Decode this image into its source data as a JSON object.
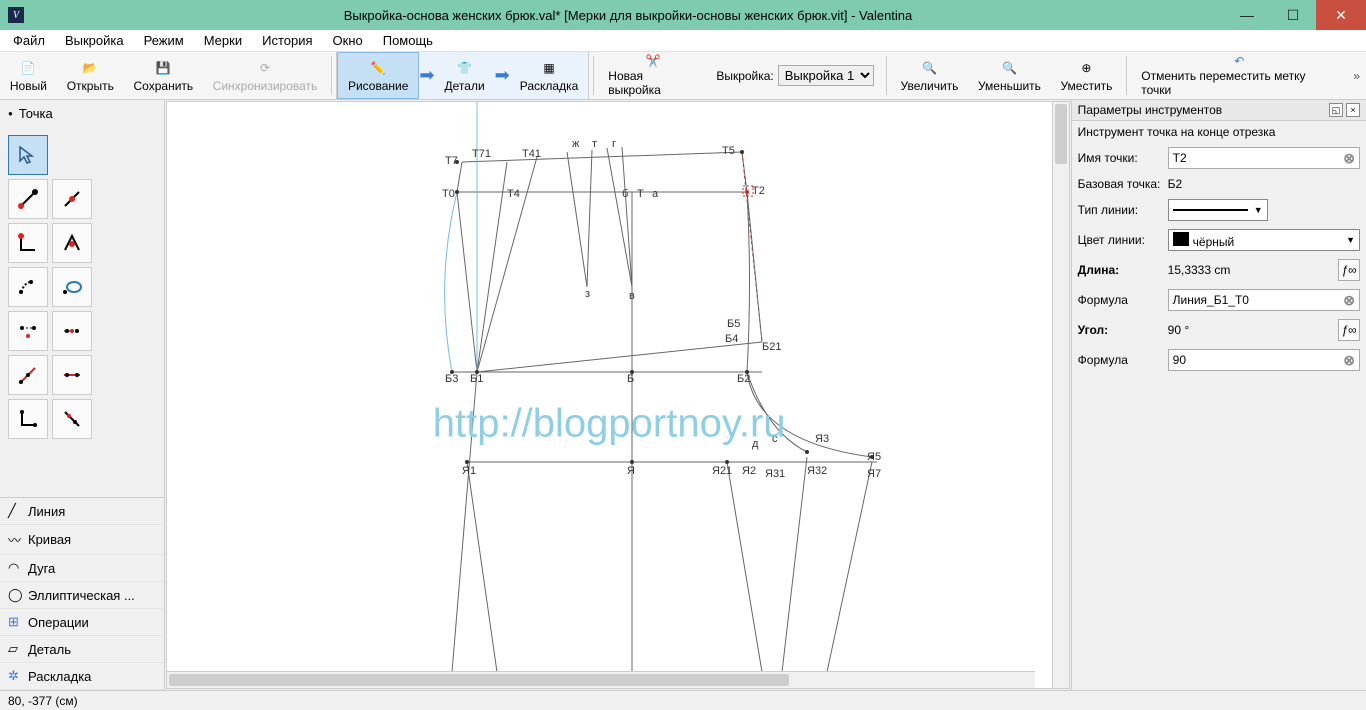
{
  "window": {
    "title": "Выкройка-основа женских брюк.val* [Мерки для выкройки-основы женских брюк.vit] - Valentina"
  },
  "menu": [
    "Файл",
    "Выкройка",
    "Режим",
    "Мерки",
    "История",
    "Окно",
    "Помощь"
  ],
  "toolbar": {
    "new": "Новый",
    "open": "Открыть",
    "save": "Сохранить",
    "sync": "Синхронизировать",
    "draw": "Рисование",
    "details": "Детали",
    "layout": "Раскладка",
    "newpattern": "Новая выкройка",
    "pattern_label": "Выкройка:",
    "pattern_value": "Выкройка 1",
    "zoomin": "Увеличить",
    "zoomout": "Уменьшить",
    "fit": "Уместить",
    "undo_move": "Отменить переместить метку точки"
  },
  "sidebar": {
    "section": "Точка",
    "cats": {
      "line": "Линия",
      "curve": "Кривая",
      "arc": "Дуга",
      "elliptic": "Эллиптическая ...",
      "ops": "Операции",
      "detail": "Деталь",
      "layout": "Раскладка"
    }
  },
  "canvas": {
    "watermark": "http://blogportnoy.ru",
    "points": {
      "T7": "Т7",
      "T71": "Т71",
      "T41": "Т41",
      "zh": "ж",
      "t": "т",
      "g": "г",
      "T5": "Т5",
      "T0": "Т0",
      "T4": "Т4",
      "B_sm": "б",
      "T": "Т",
      "a": "а",
      "T2": "Т2",
      "zv": "з",
      "v": "в",
      "B4": "Б4",
      "B5": "Б5",
      "B21": "Б21",
      "B3": "Б3",
      "B1": "Б1",
      "B": "Б",
      "B2": "Б2",
      "d": "д",
      "c": "с",
      "Ya3_r": "Я3",
      "Ya1": "Я1",
      "Ya": "Я",
      "Ya21": "Я21",
      "Ya2": "Я2",
      "Ya31": "Я31",
      "Ya32": "Я32",
      "Ya5": "Я5",
      "Ya7": "Я7"
    }
  },
  "props": {
    "title": "Параметры инструментов",
    "subtitle": "Инструмент точка на конце отрезка",
    "name_label": "Имя точки:",
    "name_value": "Т2",
    "base_label": "Базовая точка:",
    "base_value": "Б2",
    "linetype_label": "Тип линии:",
    "linecolor_label": "Цвет линии:",
    "linecolor_value": "чёрный",
    "length_label": "Длина:",
    "length_value": "15,3333 сm",
    "formula_label": "Формула",
    "formula_value": "Линия_Б1_Т0",
    "angle_label": "Угол:",
    "angle_value": "90 °",
    "angle_formula": "90"
  },
  "status": "80, -377 (см)"
}
